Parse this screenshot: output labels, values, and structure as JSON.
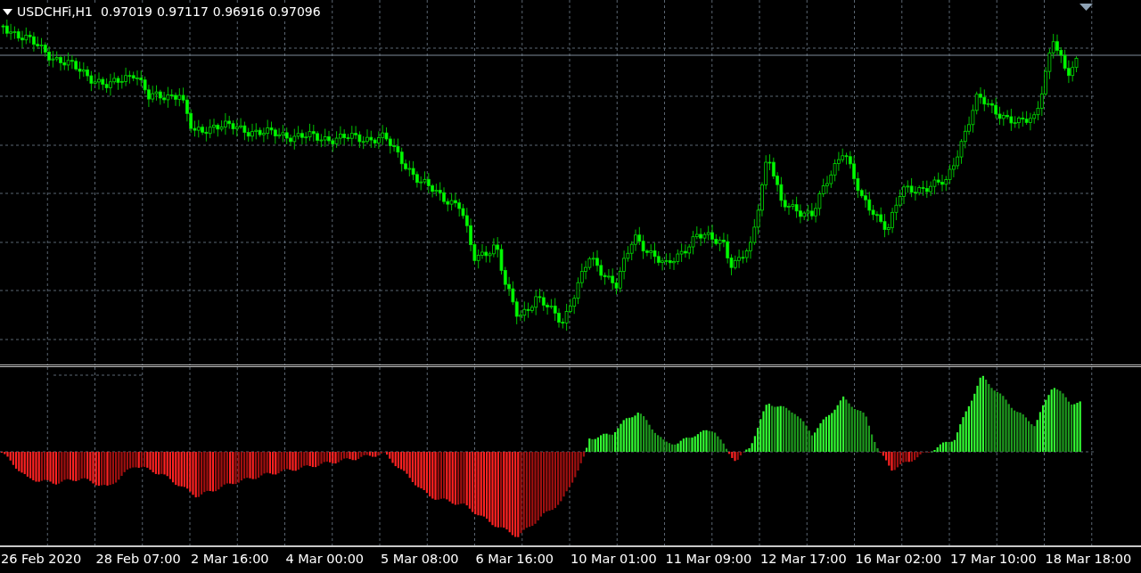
{
  "chart": {
    "symbol": "USDCHFi,H1",
    "open": "0.97019",
    "high": "0.97117",
    "low": "0.96916",
    "close": "0.97096"
  },
  "time_axis": {
    "labels": [
      "26 Feb 2020",
      "28 Feb 07:00",
      "2 Mar 16:00",
      "4 Mar 00:00",
      "5 Mar 08:00",
      "6 Mar 16:00",
      "10 Mar 01:00",
      "11 Mar 09:00",
      "12 Mar 17:00",
      "16 Mar 02:00",
      "17 Mar 10:00",
      "18 Mar 18:00"
    ]
  }
}
